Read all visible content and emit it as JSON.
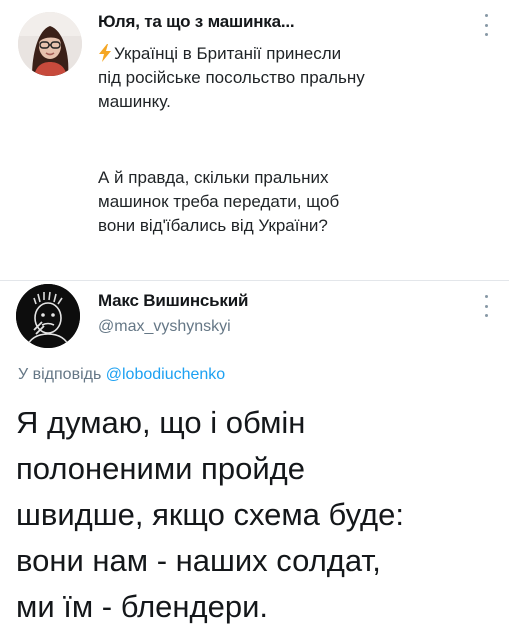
{
  "tweet": {
    "author_name": "Юля, та що з машинка...",
    "text_lines_1": [
      "Українці в Британії принесли",
      "під російське посольство пральну",
      "машинку."
    ],
    "text_lines_2": [
      "А й правда, скільки пральних",
      "машинок треба передати, щоб",
      "вони від'їбались від України?"
    ],
    "icons": {
      "lead": "lightning-icon",
      "menu": "more-vertical-icon"
    }
  },
  "reply": {
    "author_name": "Макс Вишинський",
    "handle": "@max_vyshynskyi",
    "reply_prefix": "У відповідь",
    "reply_mention": "@lobodiuchenko",
    "text_lines": [
      "Я думаю, що і обмін",
      "полоненими пройде",
      "швидше, якщо схема буде:",
      "вони нам - наших солдат,",
      "ми їм - блендери."
    ]
  },
  "colors": {
    "text": "#14171a",
    "secondary": "#657786",
    "link": "#1da1f2",
    "lightning": "#f5a623",
    "divider": "#e3e6ea"
  }
}
